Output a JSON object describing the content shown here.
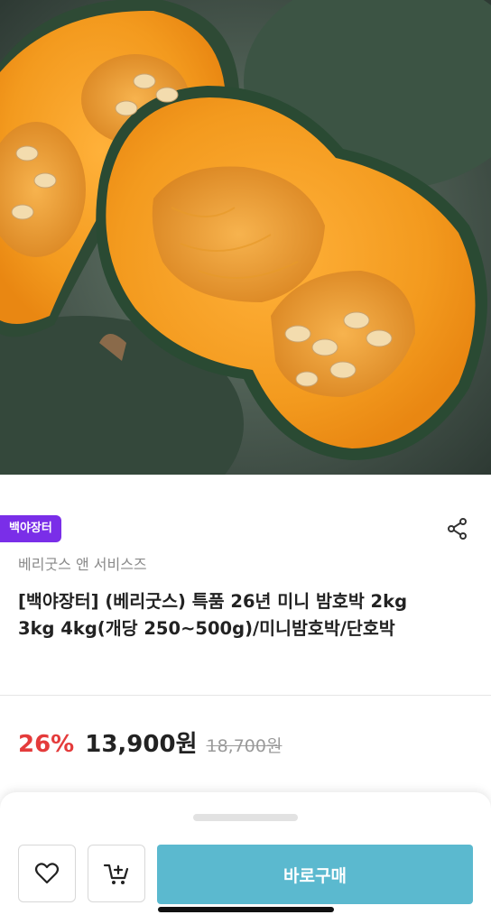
{
  "hero": {
    "image": "pumpkin-halves-photo"
  },
  "seller": {
    "badge": "백야장터"
  },
  "actions": {
    "share_icon": "share-icon"
  },
  "product": {
    "brand": "베리굿스 앤 서비스즈",
    "title": "[백야장터] (베리굿스) 특품 26년 미니 밤호박 2kg 3kg 4kg(개당 250~500g)/미니밤호박/단호박"
  },
  "pricing": {
    "discount": "26%",
    "price": "13,900원",
    "original": "18,700원"
  },
  "bottom_bar": {
    "wish_icon": "heart-icon",
    "cart_icon": "add-to-cart-icon",
    "buy_label": "바로구매"
  },
  "colors": {
    "badge": "#7a2ee8",
    "discount": "#e43b3b",
    "buy_button": "#5bb9cf"
  }
}
